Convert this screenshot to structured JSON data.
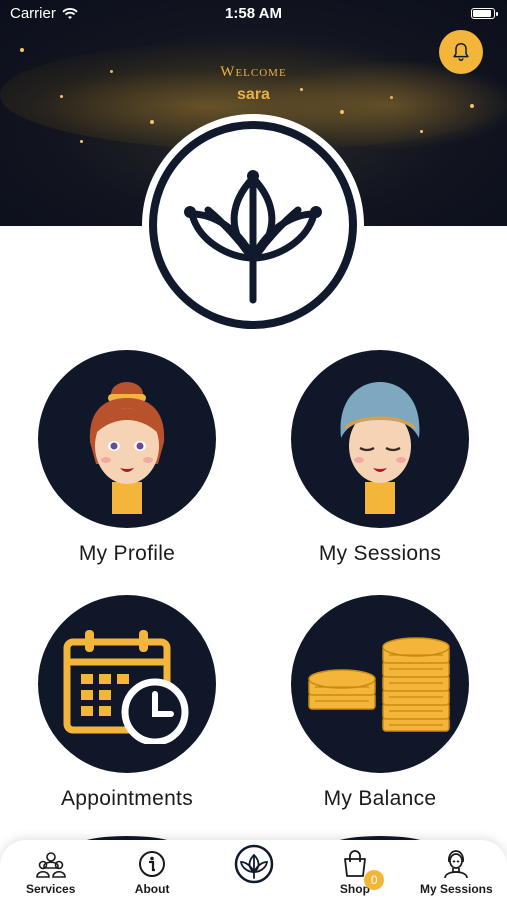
{
  "status_bar": {
    "carrier": "Carrier",
    "time": "1:58 AM"
  },
  "header": {
    "welcome_text": "Welcome",
    "username": "sara"
  },
  "tiles": [
    {
      "label": "My Profile",
      "icon": "woman-avatar-icon"
    },
    {
      "label": "My Sessions",
      "icon": "woman-towel-avatar-icon"
    },
    {
      "label": "Appointments",
      "icon": "calendar-clock-icon"
    },
    {
      "label": "My Balance",
      "icon": "coins-icon"
    }
  ],
  "tabbar": {
    "items": [
      {
        "label": "Services",
        "icon": "group-people-icon"
      },
      {
        "label": "About",
        "icon": "info-icon"
      },
      {
        "label": "",
        "icon": "lotus-logo-icon"
      },
      {
        "label": "Shop",
        "icon": "shopping-bag-icon",
        "badge": "0"
      },
      {
        "label": "My Sessions",
        "icon": "user-profile-icon"
      }
    ]
  },
  "colors": {
    "navy": "#0f1729",
    "gold": "#f4b63a",
    "accent_text": "#e7b24a"
  }
}
